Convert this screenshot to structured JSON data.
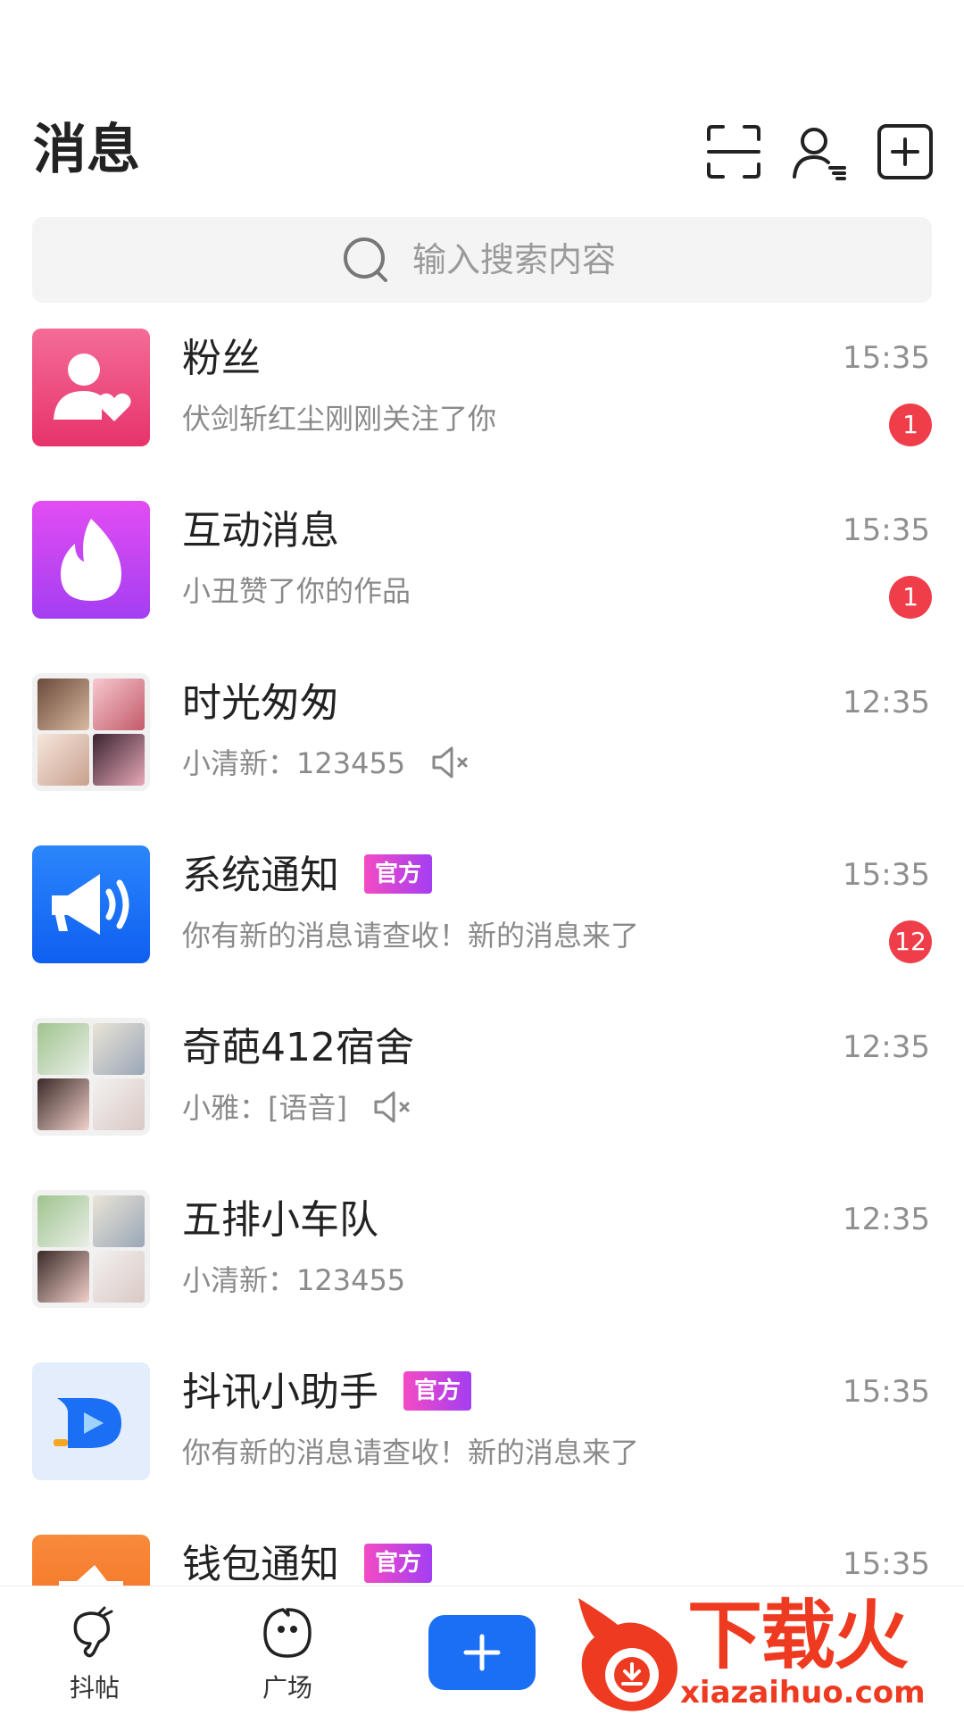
{
  "header": {
    "title": "消息",
    "icons": [
      "scan-icon",
      "contacts-icon",
      "add-square-icon"
    ]
  },
  "search": {
    "placeholder": "输入搜索内容"
  },
  "conversations": [
    {
      "name": "粉丝",
      "subtitle": "伏剑斩红尘刚刚关注了你",
      "time": "15:35",
      "badge": "1",
      "avatar": "fans-icon"
    },
    {
      "name": "互动消息",
      "subtitle": "小丑赞了你的作品",
      "time": "15:35",
      "badge": "1",
      "avatar": "fire-icon"
    },
    {
      "name": "时光匆匆",
      "subtitle": "小清新：123455",
      "time": "12:35",
      "muted": true,
      "avatar": "group-avatar"
    },
    {
      "name": "系统通知",
      "tag": "官方",
      "subtitle": "你有新的消息请查收！新的消息来了",
      "time": "15:35",
      "badge": "12",
      "avatar": "megaphone-icon"
    },
    {
      "name": "奇葩412宿舍",
      "subtitle": "小雅：[语音]",
      "time": "12:35",
      "muted": true,
      "avatar": "group-avatar"
    },
    {
      "name": "五排小车队",
      "subtitle": "小清新：123455",
      "time": "12:35",
      "avatar": "group-avatar"
    },
    {
      "name": "抖讯小助手",
      "tag": "官方",
      "subtitle": "你有新的消息请查收！新的消息来了",
      "time": "15:35",
      "avatar": "assistant-logo"
    },
    {
      "name": "钱包通知",
      "tag": "官方",
      "subtitle": "",
      "time": "15:35",
      "avatar": "wallet-icon"
    }
  ],
  "bottom_nav": [
    {
      "label": "抖帖",
      "icon": "drumstick-icon"
    },
    {
      "label": "广场",
      "icon": "bubble-face-icon"
    },
    {
      "label": "",
      "icon": "plus-icon"
    }
  ],
  "watermark": {
    "title": "下载火",
    "url": "xiazaihuo.com"
  },
  "colors": {
    "accent": "#1b6ff5",
    "badge": "#ef3e4a",
    "fans": "#ee4f86",
    "interact": "#c53ff0",
    "system": "#1a74f6",
    "wallet": "#f7772c"
  }
}
